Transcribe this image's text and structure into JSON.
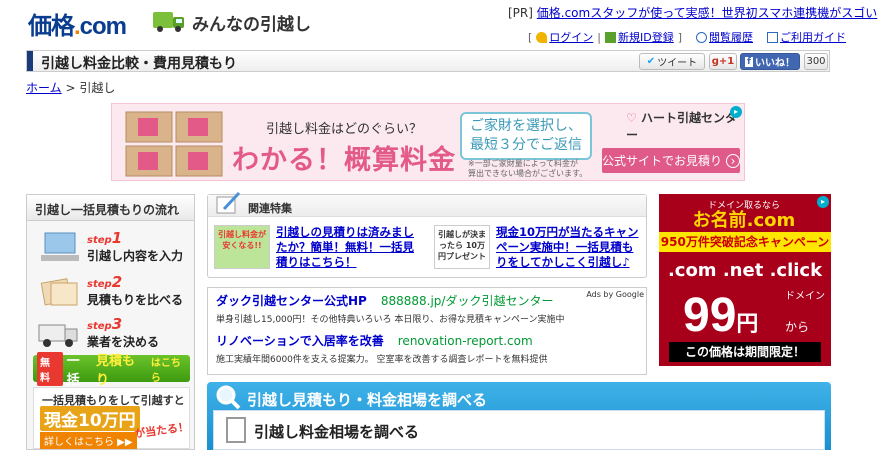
{
  "header": {
    "logo_main": "価格",
    "logo_dot": ".",
    "logo_com": "com",
    "subtitle": "みんなの引越し",
    "pr_label": "[PR]",
    "pr_text": "価格.comスタッフが使って実感！世界初スマホ連携機がスゴい",
    "links": {
      "bracket_open": "[",
      "login": "ログイン",
      "register": "新規ID登録",
      "bracket_close": "]",
      "history": "閲覧履歴",
      "guide": "ご利用ガイド"
    }
  },
  "titlebar": {
    "title": "引越し料金比較・費用見積もり",
    "tweet": "ツイート",
    "gplus": "g+1",
    "like": "いいね！",
    "like_count": "300"
  },
  "breadcrumb": {
    "home": "ホーム",
    "sep": " > ",
    "current": "引越し"
  },
  "banner": {
    "question": "引越し料金はどのぐらい？",
    "headline": "わかる！概算料金",
    "mid_line1": "ご家財を選択し、",
    "mid_line2": "最短３分でご返信",
    "note_line1": "※一部ご家財量によって料金が",
    "note_line2": "算出できない場合がございます。",
    "brand": "ハート引越センター",
    "cta": "公式サイトでお見積り",
    "cta_arrow": "›"
  },
  "flow": {
    "heading": "引越し一括見積もりの流れ",
    "steps": [
      {
        "step": "step",
        "num": "1",
        "text": "引越し内容を入力"
      },
      {
        "step": "step",
        "num": "2",
        "text": "見積もりを比べる"
      },
      {
        "step": "step",
        "num": "3",
        "text": "業者を決める"
      }
    ],
    "button_free": "無料",
    "button_text_a": "一括",
    "button_text_b": "見積もり",
    "button_text_c": "はこちら",
    "promo_l1": "一括見積もりをして引越すと",
    "promo_l2": "現金10万円",
    "promo_l3": "が当たる！",
    "promo_l4": "詳しくはこちら ▶▶"
  },
  "feature": {
    "heading": "関連特集",
    "items": [
      {
        "thumb": "引越し料金が安くなる!!",
        "link": "引越しの見積りは済みましたか？簡単！無料！一括見積りはこちら！"
      },
      {
        "thumb": "引越しが決まったら 10万円プレゼント",
        "link": "現金10万円が当たるキャンペーン実施中！一括見積もりをしてかしこく引越し♪"
      }
    ]
  },
  "ads": {
    "badge": "Ads by Google",
    "items": [
      {
        "headline": "ダック引越センター公式HP",
        "url": "888888.jp/ダック引越センター",
        "desc": "単身引越し15,000円！その他特典いろいろ 本日限り、お得な見積キャンペーン実施中"
      },
      {
        "headline": "リノベーションで入居率を改善",
        "url": "renovation-report.com",
        "desc": "施工実績年間6000件を支える提案力。 空室率を改善する調査レポートを無料提供"
      }
    ]
  },
  "estimate": {
    "heading": "引越し見積もり・料金相場を調べる",
    "subheading": "引越し料金相場を調べる"
  },
  "right_ad": {
    "top": "ドメイン取るなら",
    "brand": "お名前.com",
    "campaign": "950万件突破記念キャンペーン",
    "domains": ".com .net .click",
    "domain_label": "ドメイン",
    "price": "99",
    "yen": "円",
    "kara": "から",
    "limit": "この価格は期間限定！"
  },
  "colors": {
    "brand_blue": "#0a3d8f",
    "brand_orange": "#f08300",
    "link": "#0000cc",
    "banner_pink": "#e35a88",
    "estimate_blue": "#1a8fd0"
  }
}
